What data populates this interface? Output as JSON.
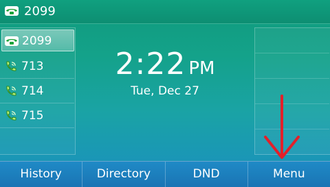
{
  "topbar": {
    "account": "2099",
    "icon": "phone-registered-icon",
    "icon_color": "#1ca33a"
  },
  "line_keys": [
    {
      "label": "2099",
      "icon": "phone-registered-icon",
      "active": true
    },
    {
      "label": "713",
      "icon": "phone-handset-icon",
      "active": false
    },
    {
      "label": "714",
      "icon": "phone-handset-icon",
      "active": false
    },
    {
      "label": "715",
      "icon": "phone-handset-icon",
      "active": false
    }
  ],
  "clock": {
    "time": "2:22",
    "ampm": "PM",
    "date": "Tue, Dec 27"
  },
  "softkeys": [
    "History",
    "Directory",
    "DND",
    "Menu"
  ],
  "annotation": {
    "type": "down-arrow",
    "color": "#e3202a"
  }
}
